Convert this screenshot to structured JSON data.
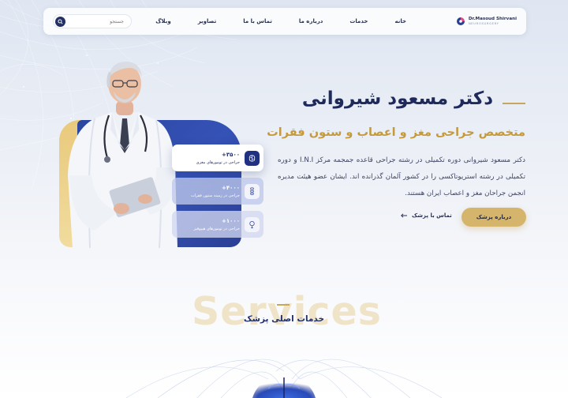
{
  "brand": {
    "name": "Dr.Masoud Shirvani",
    "subtitle": "NEUROSURGERY"
  },
  "nav": {
    "items": [
      "خانه",
      "خدمات",
      "درباره ما",
      "تماس با ما",
      "تصاویر",
      "وبلاگ"
    ],
    "search_placeholder": "جستجو"
  },
  "hero": {
    "name": "دکتر مسعود شیروانی",
    "title": "متخصص جراحی مغز و اعصاب و ستون فقرات",
    "description": "دکتر مسعود شیروانی دوره تکمیلی در رشته جراحی قاعده جمجمه مرکز I.N.I و دوره تکمیلی در رشته استریوتاکسی را در کشور آلمان گذرانده اند. ایشان عضو هیئت مدیره انجمن جراحان مغز و اعصاب ایران هستند.",
    "primary_button": "درباره پزشک",
    "secondary_link": "تماس با پزشک"
  },
  "stats": [
    {
      "number": "+۳۵۰۰",
      "label": "جراحی در تومورهای مغزی",
      "icon": "brain-icon"
    },
    {
      "number": "+۴۰۰۰",
      "label": "جراحی در زمینه ستون فقرات",
      "icon": "spine-icon"
    },
    {
      "number": "+۱۰۰۰",
      "label": "جراحی در تومورهای هیپوفیز",
      "icon": "pituitary-icon"
    }
  ],
  "services": {
    "bg_text": "Services",
    "title": "خدمات اصلی پزشک"
  },
  "colors": {
    "navy": "#1f2a5c",
    "gold": "#c49a3c",
    "blue": "#3552b6",
    "button": "#d5b56c"
  }
}
